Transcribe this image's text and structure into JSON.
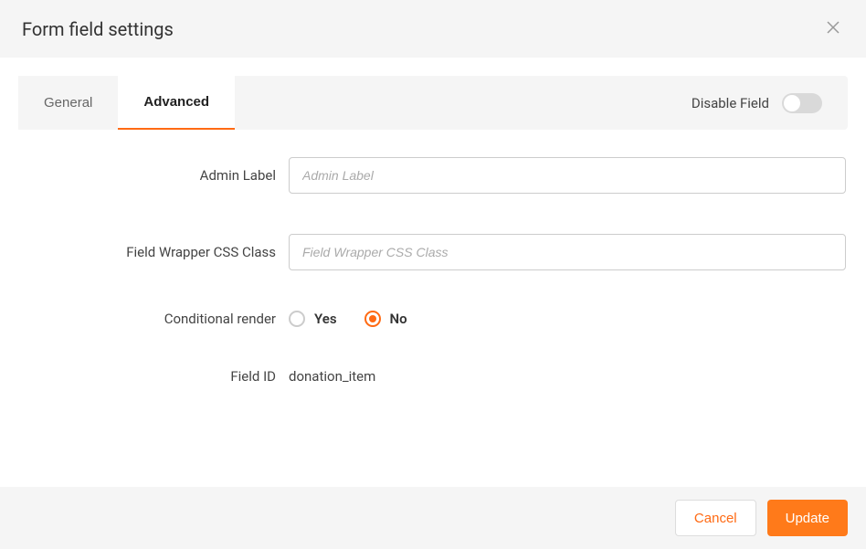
{
  "header": {
    "title": "Form field settings"
  },
  "tabs": {
    "general": {
      "label": "General"
    },
    "advanced": {
      "label": "Advanced"
    }
  },
  "disableField": {
    "label": "Disable Field",
    "value": false
  },
  "fields": {
    "adminLabel": {
      "label": "Admin Label",
      "placeholder": "Admin Label",
      "value": ""
    },
    "wrapperClass": {
      "label": "Field Wrapper CSS Class",
      "placeholder": "Field Wrapper CSS Class",
      "value": ""
    },
    "conditionalRender": {
      "label": "Conditional render",
      "options": {
        "yes": "Yes",
        "no": "No"
      },
      "selected": "no"
    },
    "fieldId": {
      "label": "Field ID",
      "value": "donation_item"
    }
  },
  "footer": {
    "cancel": "Cancel",
    "update": "Update"
  }
}
